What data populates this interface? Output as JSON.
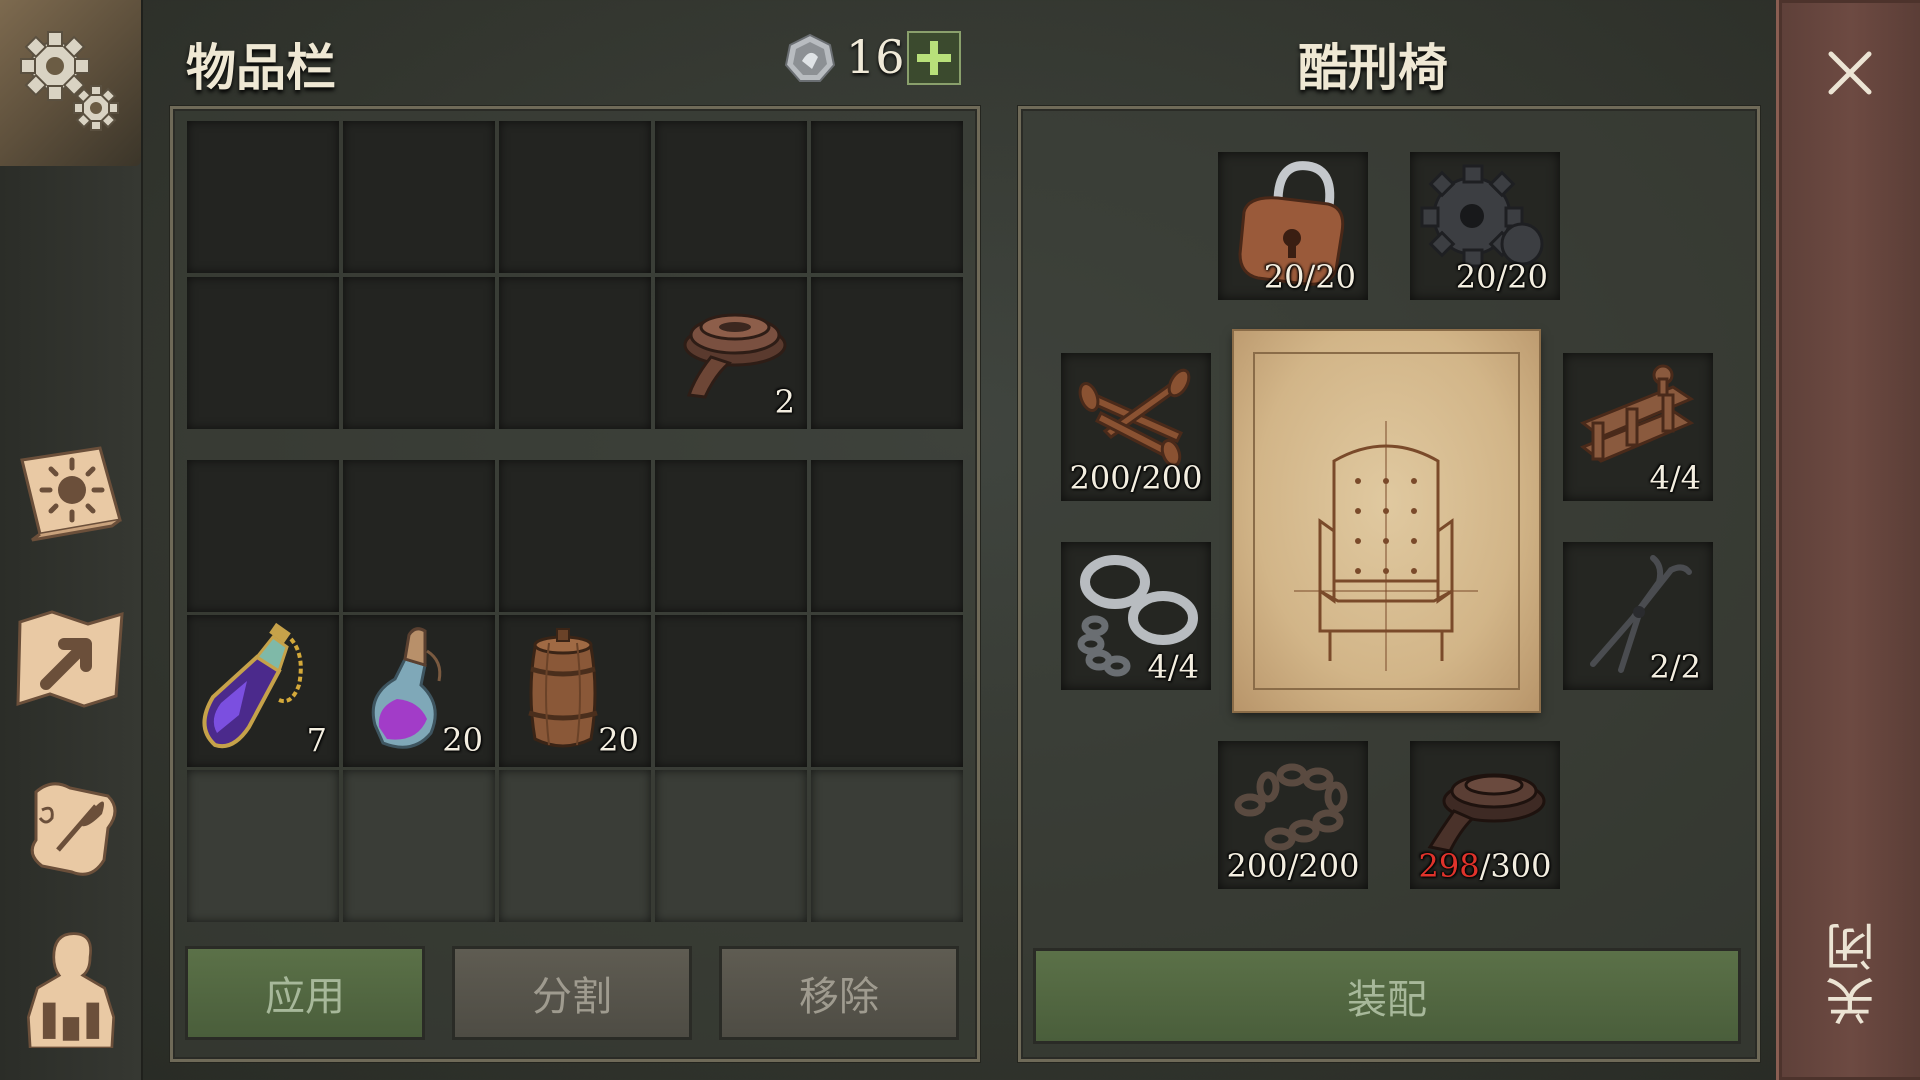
{
  "inventory": {
    "title": "物品栏",
    "currency": {
      "icon": "silver-coin-icon",
      "amount": "16",
      "add_icon": "plus-icon"
    },
    "items": [
      {
        "icon": "leather-strap-icon",
        "count": "2"
      },
      {
        "icon": "purple-elixir-flask-icon",
        "count": "7"
      },
      {
        "icon": "purple-potion-bottle-icon",
        "count": "20"
      },
      {
        "icon": "wooden-barrel-icon",
        "count": "20"
      }
    ],
    "buttons": {
      "apply": "应用",
      "split": "分割",
      "remove": "移除"
    }
  },
  "crafting": {
    "title": "酷刑椅",
    "blueprint_icon": "torture-chair-blueprint-icon",
    "materials": [
      {
        "icon": "padlock-icon",
        "count": "20/20"
      },
      {
        "icon": "gear-icon",
        "count": "20/20"
      },
      {
        "icon": "nails-icon",
        "count": "200/200"
      },
      {
        "icon": "spike-bracket-icon",
        "count": "4/4"
      },
      {
        "icon": "shackles-icon",
        "count": "4/4"
      },
      {
        "icon": "pliers-icon",
        "count": "2/2"
      },
      {
        "icon": "iron-chain-icon",
        "count": "200/200"
      },
      {
        "icon": "leather-strap-icon",
        "have": "298",
        "need": "/300"
      }
    ],
    "assemble_label": "装配"
  },
  "close": {
    "icon": "close-x-icon",
    "label": "关闭"
  },
  "sidebar": {
    "icons": [
      "settings-gears-icon",
      "sun-book-icon",
      "map-arrow-icon",
      "quest-scroll-icon",
      "character-backpack-icon"
    ]
  },
  "colors": {
    "insufficient": "#e0332b",
    "accent_green": "#4f643f",
    "close_panel": "#6d4a42"
  }
}
